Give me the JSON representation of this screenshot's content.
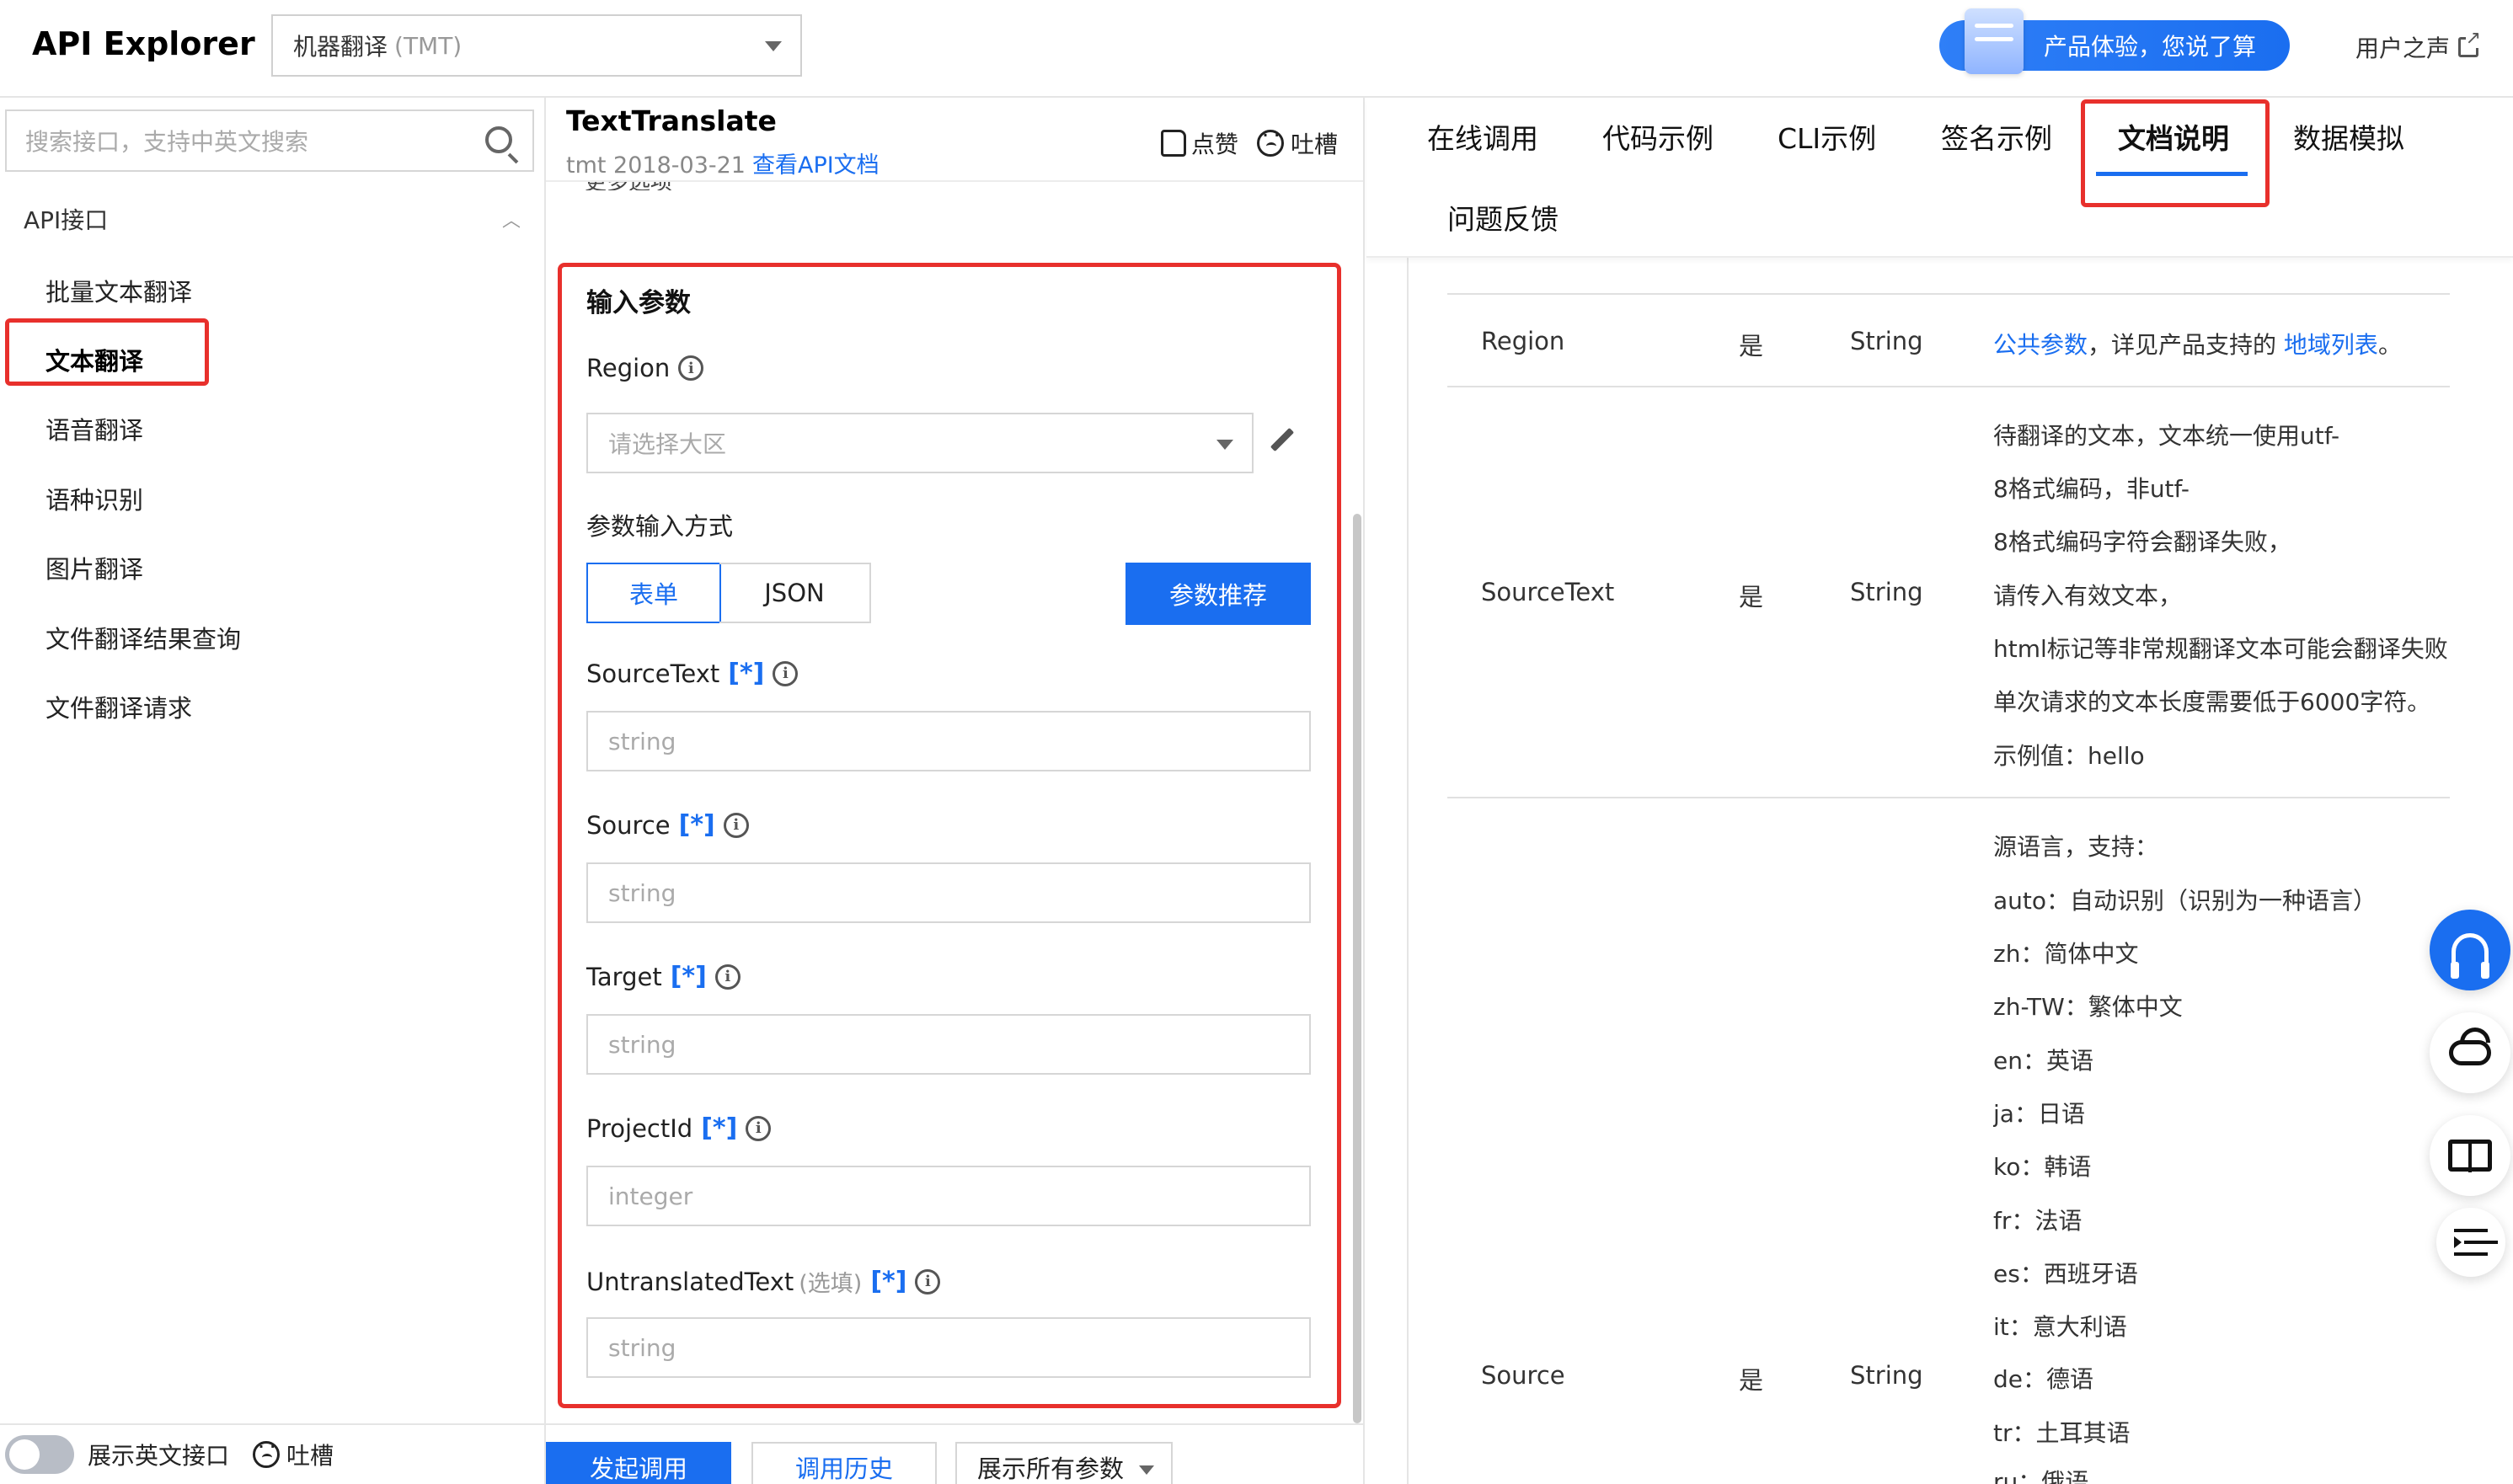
{
  "header": {
    "brand": "API Explorer",
    "product": "机器翻译",
    "product_sub": "(TMT)",
    "promo": "产品体验，您说了算",
    "user_voice": "用户之声"
  },
  "sidebar": {
    "search_placeholder": "搜索接口，支持中英文搜索",
    "section": "API接口",
    "items": [
      {
        "label": "批量文本翻译"
      },
      {
        "label": "文本翻译"
      },
      {
        "label": "语音翻译"
      },
      {
        "label": "语种识别"
      },
      {
        "label": "图片翻译"
      },
      {
        "label": "文件翻译结果查询"
      },
      {
        "label": "文件翻译请求"
      }
    ],
    "toggle_label": "展示英文接口",
    "complain": "吐槽"
  },
  "middle": {
    "title": "TextTranslate",
    "version": "tmt 2018-03-21",
    "doc_link": "查看API文档",
    "like": "点赞",
    "complain": "吐槽",
    "cut_text": "更多选项",
    "section_title": "输入参数",
    "region_label": "Region",
    "region_placeholder": "请选择大区",
    "input_mode_label": "参数输入方式",
    "mode_form": "表单",
    "mode_json": "JSON",
    "recommend": "参数推荐",
    "required_mark": "[*]",
    "fields": [
      {
        "label": "SourceText",
        "placeholder": "string"
      },
      {
        "label": "Source",
        "placeholder": "string"
      },
      {
        "label": "Target",
        "placeholder": "string"
      },
      {
        "label": "ProjectId",
        "placeholder": "integer"
      },
      {
        "label": "UntranslatedText",
        "optional": "(选填)",
        "placeholder": "string"
      }
    ],
    "invoke": "发起调用",
    "history": "调用历史",
    "show_all": "展示所有参数"
  },
  "right": {
    "tabs": [
      "在线调用",
      "代码示例",
      "CLI示例",
      "签名示例",
      "文档说明",
      "数据模拟",
      "问题反馈"
    ],
    "rows": [
      {
        "name": "Region",
        "required": "是",
        "type": "String",
        "desc_link1": "公共参数",
        "desc_mid": "，详见产品支持的 ",
        "desc_link2": "地域列表",
        "desc_end": "。"
      },
      {
        "name": "SourceText",
        "required": "是",
        "type": "String",
        "lines": [
          "待翻译的文本，文本统一使用utf-",
          "8格式编码，非utf-",
          "8格式编码字符会翻译失败，",
          "请传入有效文本，",
          "html标记等非常规翻译文本可能会翻译失败",
          "单次请求的文本长度需要低于6000字符。",
          "示例值：hello"
        ]
      },
      {
        "name": "Source",
        "required": "是",
        "type": "String",
        "lines": [
          "源语言，支持：",
          "auto：自动识别（识别为一种语言）",
          "zh：简体中文",
          "zh-TW：繁体中文",
          "en：英语",
          "ja：日语",
          "ko：韩语",
          "fr：法语",
          "es：西班牙语",
          "it：意大利语",
          "de：德语",
          "tr：土耳其语",
          "ru：俄语"
        ]
      }
    ]
  }
}
